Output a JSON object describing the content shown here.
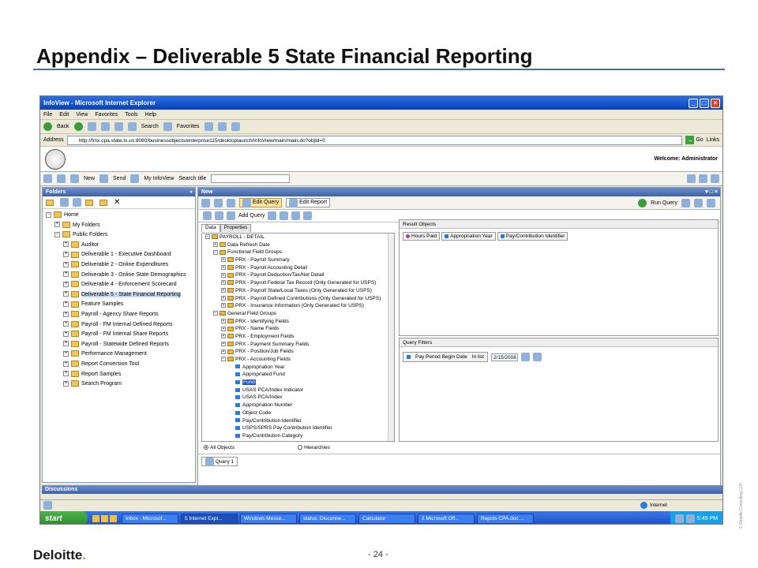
{
  "slide": {
    "title": "Appendix – Deliverable 5 State Financial Reporting",
    "page_number": "- 24 -",
    "logo": "Deloitte",
    "logo_dot": ".",
    "side_note": "© Deloitte Consulting LLP"
  },
  "window": {
    "title": "InfoView - Microsoft Internet Explorer"
  },
  "menu": [
    "File",
    "Edit",
    "View",
    "Favorites",
    "Tools",
    "Help"
  ],
  "toolbar": {
    "back": "Back",
    "search": "Search",
    "favorites": "Favorites"
  },
  "address": {
    "label": "Address",
    "url": "http://fmx.cpa.state.tx.us:8080/businessobjects/enterprise115/desktoplaunch/InfoView/main/main.do?objId=0",
    "go": "Go",
    "links": "Links"
  },
  "bo": {
    "welcome": "Welcome: Administrator",
    "new": "New",
    "send": "Send",
    "my_infoview": "My InfoView",
    "search_title": "Search title"
  },
  "left_panel": {
    "title": "Folders",
    "items": [
      {
        "label": "Home",
        "pm": "−",
        "indent": 0
      },
      {
        "label": "My Folders",
        "pm": "+",
        "indent": 1
      },
      {
        "label": "Public Folders",
        "pm": "−",
        "indent": 1
      },
      {
        "label": "Auditor",
        "pm": "+",
        "indent": 2
      },
      {
        "label": "Deliverable 1 - Executive Dashboard",
        "pm": "+",
        "indent": 2
      },
      {
        "label": "Deliverable 2 - Online Expenditures",
        "pm": "+",
        "indent": 2
      },
      {
        "label": "Deliverable 3 - Online State Demographics",
        "pm": "+",
        "indent": 2
      },
      {
        "label": "Deliverable 4 - Enforcement Scorecard",
        "pm": "+",
        "indent": 2
      },
      {
        "label": "Deliverable 5 - State Financial Reporting",
        "pm": "+",
        "indent": 2,
        "selected": true
      },
      {
        "label": "Feature Samples",
        "pm": "+",
        "indent": 2
      },
      {
        "label": "Payroll - Agency Share Reports",
        "pm": "+",
        "indent": 2
      },
      {
        "label": "Payroll - FM Internal Defined Reports",
        "pm": "+",
        "indent": 2
      },
      {
        "label": "Payroll - FM Internal Share Reports",
        "pm": "+",
        "indent": 2
      },
      {
        "label": "Payroll - Statewide Defined Reports",
        "pm": "+",
        "indent": 2
      },
      {
        "label": "Performance Management",
        "pm": "+",
        "indent": 2
      },
      {
        "label": "Report Conversion Tool",
        "pm": "+",
        "indent": 2
      },
      {
        "label": "Report Samples",
        "pm": "+",
        "indent": 2
      },
      {
        "label": "Search Program",
        "pm": "+",
        "indent": 2
      }
    ]
  },
  "query_panel": {
    "title": "New",
    "edit_query": "Edit Query",
    "edit_report": "Edit Report",
    "run_query": "Run Query",
    "add_query": "Add Query",
    "tabs": [
      "Data",
      "Properties"
    ],
    "tree": [
      {
        "label": "PAYROLL - DETAIL",
        "pm": "−",
        "indent": 0,
        "icon": "universe"
      },
      {
        "label": "Data Refresh Date",
        "pm": "+",
        "indent": 1,
        "icon": "folder"
      },
      {
        "label": "Functional Field Groups",
        "pm": "−",
        "indent": 1,
        "icon": "folder"
      },
      {
        "label": "PRX - Payroll Summary",
        "pm": "+",
        "indent": 2,
        "icon": "folder"
      },
      {
        "label": "PRX - Payroll Accounting Detail",
        "pm": "+",
        "indent": 2,
        "icon": "folder"
      },
      {
        "label": "PRX - Payroll Deduction/Tax/Net Detail",
        "pm": "+",
        "indent": 2,
        "icon": "folder"
      },
      {
        "label": "PRX - Payroll Federal Tax Record (Only Generated for USPS)",
        "pm": "+",
        "indent": 2,
        "icon": "folder"
      },
      {
        "label": "PRX - Payroll State/Local Taxes (Only Generated for USPS)",
        "pm": "+",
        "indent": 2,
        "icon": "folder"
      },
      {
        "label": "PRX - Payroll Defined Contributions (Only Generated for USPS)",
        "pm": "+",
        "indent": 2,
        "icon": "folder"
      },
      {
        "label": "PRX - Insurance Information (Only Generated for USPS)",
        "pm": "+",
        "indent": 2,
        "icon": "folder"
      },
      {
        "label": "General Field Groups",
        "pm": "−",
        "indent": 1,
        "icon": "folder"
      },
      {
        "label": "PRX - Identifying Fields",
        "pm": "+",
        "indent": 2,
        "icon": "folder"
      },
      {
        "label": "PRX - Name Fields",
        "pm": "+",
        "indent": 2,
        "icon": "folder"
      },
      {
        "label": "PRX - Employment Fields",
        "pm": "+",
        "indent": 2,
        "icon": "folder"
      },
      {
        "label": "PRX - Payment Summary Fields",
        "pm": "+",
        "indent": 2,
        "icon": "folder"
      },
      {
        "label": "PRX - Position/Job Fields",
        "pm": "+",
        "indent": 2,
        "icon": "folder"
      },
      {
        "label": "PRX - Accounting Fields",
        "pm": "−",
        "indent": 2,
        "icon": "folder"
      },
      {
        "label": "Appropriation Year",
        "indent": 3,
        "icon": "object"
      },
      {
        "label": "Appropriated Fund",
        "indent": 3,
        "icon": "object"
      },
      {
        "label": "Fund",
        "indent": 3,
        "icon": "object",
        "selected": true
      },
      {
        "label": "USAS PCA/Index Indicator",
        "indent": 3,
        "icon": "object"
      },
      {
        "label": "USAS PCA/Index",
        "indent": 3,
        "icon": "object"
      },
      {
        "label": "Appropriation Number",
        "indent": 3,
        "icon": "object"
      },
      {
        "label": "Object Code",
        "indent": 3,
        "icon": "object"
      },
      {
        "label": "Pay/Contribution Identifier",
        "indent": 3,
        "icon": "object"
      },
      {
        "label": "USPS/SPRS Pay Contribution Identifier",
        "indent": 3,
        "icon": "object"
      },
      {
        "label": "Pay/Contribution Category",
        "indent": 3,
        "icon": "object"
      }
    ],
    "radio_all": "All Objects",
    "radio_hier": "Hierarchies",
    "result_title": "Result Objects",
    "result_objects": [
      {
        "label": "Hours Paid",
        "kind": "measure"
      },
      {
        "label": "Appropriation Year",
        "kind": "dimension"
      },
      {
        "label": "Pay/Contribution Identifier",
        "kind": "dimension"
      }
    ],
    "filters_title": "Query Filters",
    "filter": {
      "field": "Pay Period Begin Date",
      "operator": "In list",
      "value": "2/15/2008"
    },
    "query_tab": "Query 1"
  },
  "discussions": "Discussions",
  "status": {
    "zone": "Internet"
  },
  "taskbar": {
    "start": "start",
    "tasks": [
      "Inbox - Microsof...",
      "5 Internet Expl...",
      "Windows Messe...",
      "status: Disconne...",
      "Calculator",
      "2 Microsoft Off...",
      "Repots CPA.doc ..."
    ],
    "time": "5:49 PM"
  }
}
